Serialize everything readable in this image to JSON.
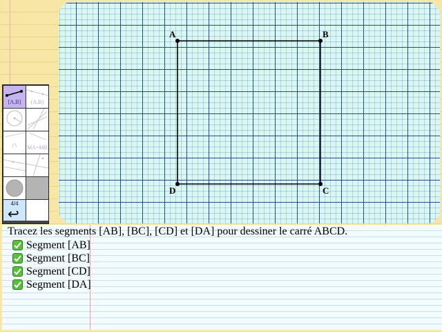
{
  "canvas": {
    "points": [
      {
        "name": "A",
        "x": 0,
        "y": 0
      },
      {
        "name": "B",
        "x": 1,
        "y": 0
      },
      {
        "name": "C",
        "x": 1,
        "y": 1
      },
      {
        "name": "D",
        "x": 0,
        "y": 1
      }
    ],
    "segments": [
      [
        "A",
        "B"
      ],
      [
        "B",
        "C"
      ],
      [
        "C",
        "D"
      ],
      [
        "D",
        "A"
      ]
    ]
  },
  "palette": {
    "tools": [
      {
        "id": "segment",
        "label": "[A,B]",
        "active": true
      },
      {
        "id": "line",
        "label": "(A,B)",
        "active": false
      },
      {
        "id": "circle",
        "label": "",
        "active": false
      },
      {
        "id": "lines",
        "label": "",
        "active": false
      },
      {
        "id": "arc",
        "label": "∩",
        "active": false
      },
      {
        "id": "equidistant",
        "label": "MA=MB",
        "active": false
      },
      {
        "id": "parallel",
        "label": "",
        "active": false
      },
      {
        "id": "perpendicular",
        "label": "",
        "active": false
      },
      {
        "id": "point",
        "label": "",
        "active": false
      },
      {
        "id": "blank",
        "label": "",
        "active": false
      }
    ],
    "page_indicator": "4/4",
    "undo_icon": "undo-icon"
  },
  "instructions": {
    "text": "Tracez les segments [AB], [BC], [CD] et [DA] pour dessiner le carré ABCD.",
    "tasks": [
      {
        "label": "Segment [AB]",
        "done": true
      },
      {
        "label": "Segment [BC]",
        "done": true
      },
      {
        "label": "Segment [CD]",
        "done": true
      },
      {
        "label": "Segment [DA]",
        "done": true
      }
    ],
    "check_color": "#5bbf3d"
  }
}
